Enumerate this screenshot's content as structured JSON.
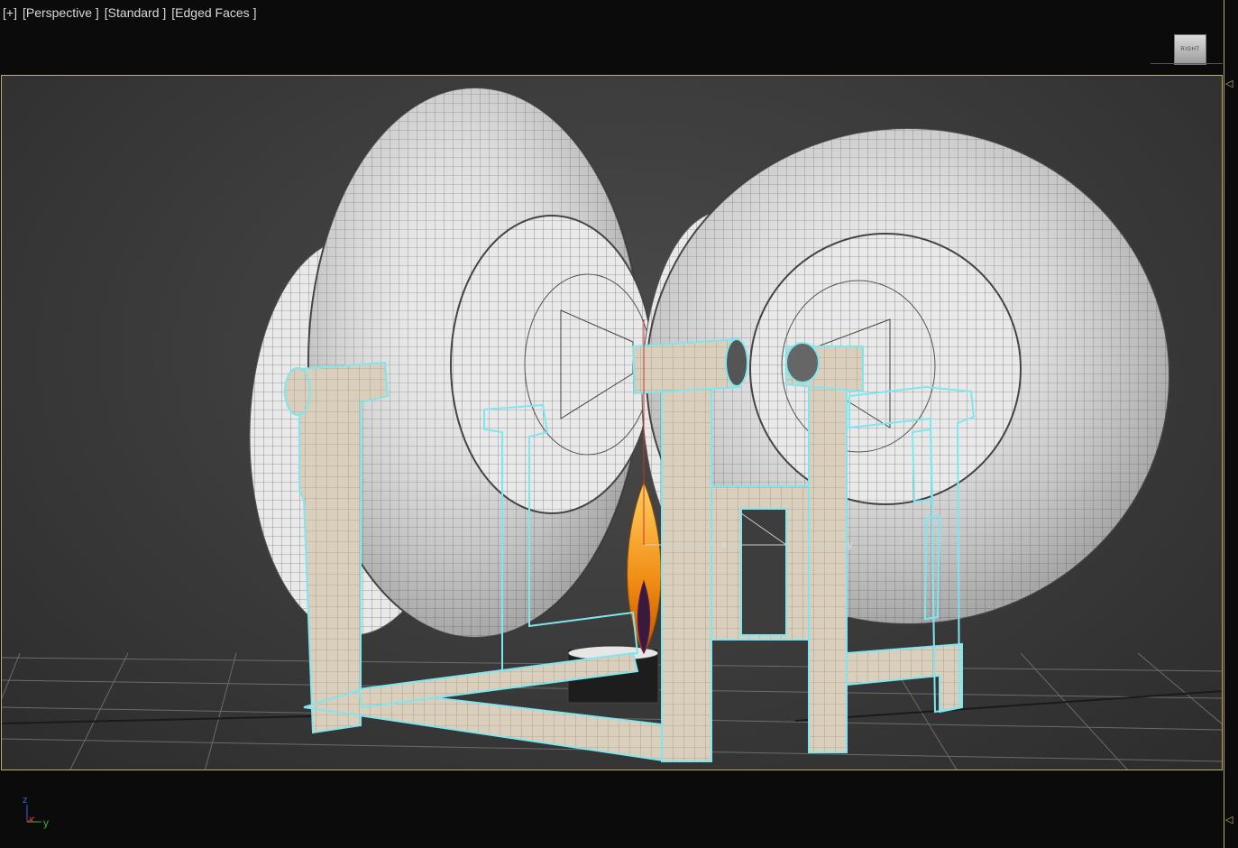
{
  "viewport": {
    "menu_label": "[+]",
    "view_label": "[Perspective ]",
    "shading_label": "[Standard ]",
    "edged_label": "[Edged Faces ]"
  },
  "viewcube": {
    "face_label": "RIGHT"
  },
  "colors": {
    "frame_border": "#bfae5a",
    "selection_outline": "#7fe6ef",
    "frame_wood": "#d8cdb8",
    "flame": "#f0a020",
    "axis_z": "#4060d0",
    "axis_x": "#d03030",
    "axis_y": "#30b040"
  },
  "axis": {
    "z": "z",
    "x": "x",
    "y": "y"
  },
  "gizmo": {
    "x": "x",
    "y": "y"
  },
  "frame_markers": {
    "top": "◁",
    "bottom": "◁"
  }
}
